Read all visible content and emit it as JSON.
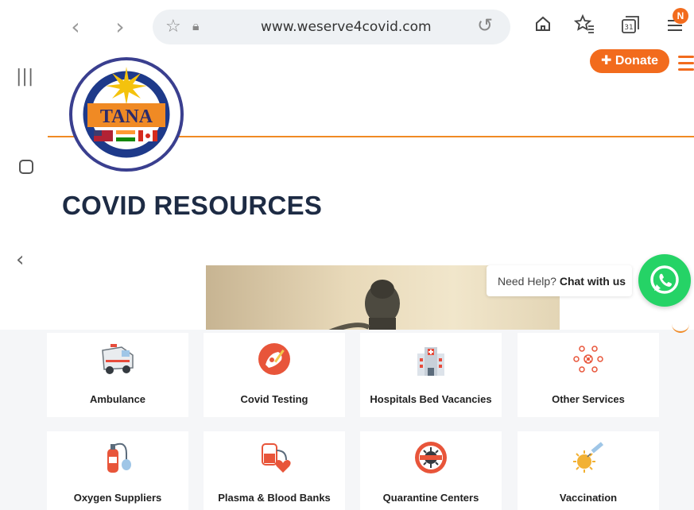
{
  "browser": {
    "url": "www.weserve4covid.com",
    "notification_badge": "N"
  },
  "site": {
    "logo_text": "TANA",
    "logo_ring_top": "TELUGU ASSOCIATION OF NORTH AMERICA, INC.",
    "logo_ring_bottom": "Our Youth are Our Heritage",
    "donate_label": "Donate",
    "donate_icon": "plus-icon",
    "page_title": "COVID RESOURCES"
  },
  "chat": {
    "prompt": "Need Help?",
    "action": "Chat with us"
  },
  "services": [
    {
      "label": "Ambulance",
      "icon": "ambulance-icon"
    },
    {
      "label": "Covid Testing",
      "icon": "covid-testing-icon"
    },
    {
      "label": "Hospitals Bed Vacancies",
      "icon": "hospital-icon"
    },
    {
      "label": "Other Services",
      "icon": "virus-network-icon"
    },
    {
      "label": "Oxygen Suppliers",
      "icon": "oxygen-cylinder-icon"
    },
    {
      "label": "Plasma & Blood Banks",
      "icon": "blood-bag-icon"
    },
    {
      "label": "Quarantine Centers",
      "icon": "quarantine-icon"
    },
    {
      "label": "Vaccination",
      "icon": "vaccine-icon"
    }
  ],
  "colors": {
    "accent": "#f26b1d",
    "title": "#1d2b44",
    "whatsapp": "#25d366"
  }
}
